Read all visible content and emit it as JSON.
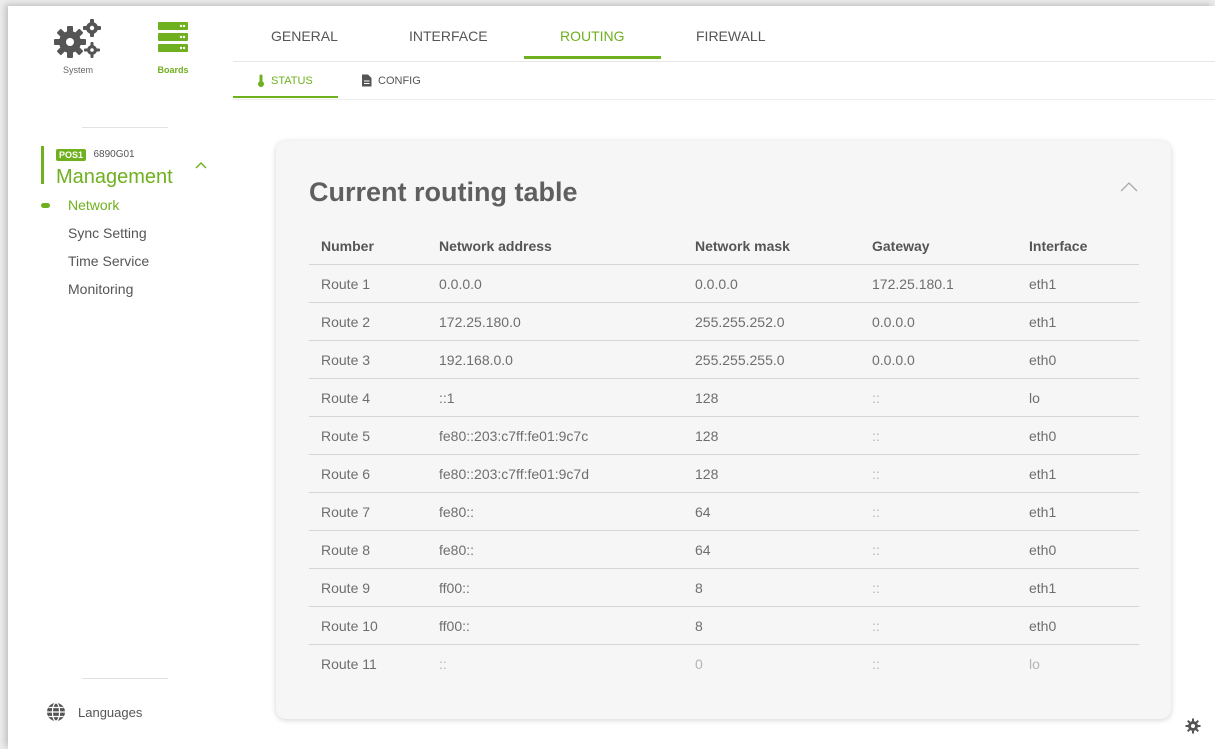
{
  "sidebar": {
    "top_buttons": [
      {
        "label": "System",
        "icon": "gears-icon"
      },
      {
        "label": "Boards",
        "icon": "boards-icon"
      }
    ],
    "device": {
      "badge": "POS1",
      "code": "6890G01",
      "title": "Management"
    },
    "nav": [
      {
        "label": "Network",
        "active": true
      },
      {
        "label": "Sync Setting",
        "active": false
      },
      {
        "label": "Time Service",
        "active": false
      },
      {
        "label": "Monitoring",
        "active": false
      }
    ],
    "languages_label": "Languages"
  },
  "tabs": [
    {
      "label": "GENERAL",
      "active": false
    },
    {
      "label": "INTERFACE",
      "active": false
    },
    {
      "label": "ROUTING",
      "active": true
    },
    {
      "label": "FIREWALL",
      "active": false
    }
  ],
  "subtabs": [
    {
      "label": "STATUS",
      "active": true,
      "icon": "thermometer-icon"
    },
    {
      "label": "CONFIG",
      "active": false,
      "icon": "document-icon"
    }
  ],
  "card": {
    "title": "Current routing table",
    "columns": [
      "Number",
      "Network address",
      "Network mask",
      "Gateway",
      "Interface"
    ],
    "rows": [
      [
        "Route 1",
        "0.0.0.0",
        "0.0.0.0",
        "172.25.180.1",
        "eth1"
      ],
      [
        "Route 2",
        "172.25.180.0",
        "255.255.252.0",
        "0.0.0.0",
        "eth1"
      ],
      [
        "Route 3",
        "192.168.0.0",
        "255.255.255.0",
        "0.0.0.0",
        "eth0"
      ],
      [
        "Route 4",
        "::1",
        "128",
        "::",
        "lo"
      ],
      [
        "Route 5",
        "fe80::203:c7ff:fe01:9c7c",
        "128",
        "::",
        "eth0"
      ],
      [
        "Route 6",
        "fe80::203:c7ff:fe01:9c7d",
        "128",
        "::",
        "eth1"
      ],
      [
        "Route 7",
        "fe80::",
        "64",
        "::",
        "eth1"
      ],
      [
        "Route 8",
        "fe80::",
        "64",
        "::",
        "eth0"
      ],
      [
        "Route 9",
        "ff00::",
        "8",
        "::",
        "eth1"
      ],
      [
        "Route 10",
        "ff00::",
        "8",
        "::",
        "eth0"
      ],
      [
        "Route 11",
        "::",
        "0",
        "::",
        "lo"
      ]
    ]
  },
  "colors": {
    "accent": "#6fb01e",
    "text": "#555555",
    "card_bg": "#f6f6f6"
  }
}
